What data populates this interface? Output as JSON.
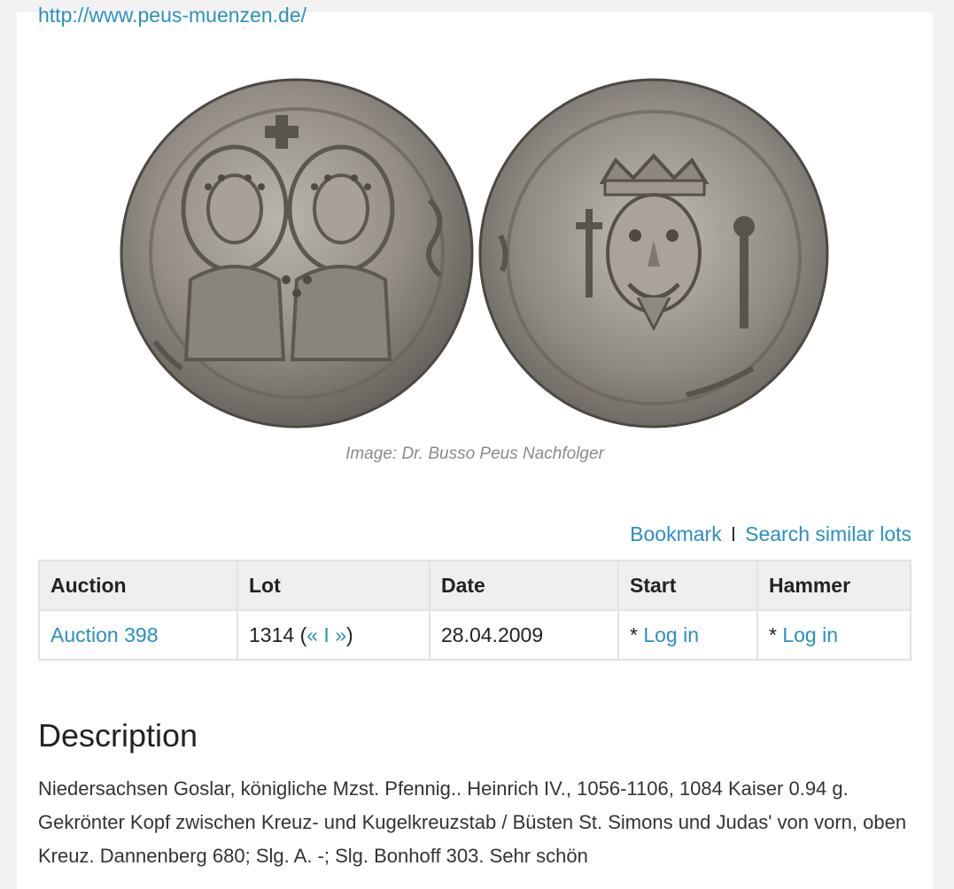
{
  "header": {
    "source_url": "http://www.peus-muenzen.de/"
  },
  "image": {
    "caption": "Image: Dr. Busso Peus Nachfolger"
  },
  "actions": {
    "bookmark": "Bookmark",
    "separator": "I",
    "search_similar": "Search similar lots"
  },
  "table": {
    "headers": [
      "Auction",
      "Lot",
      "Date",
      "Start",
      "Hammer"
    ],
    "row": {
      "auction": "Auction 398",
      "lot_number": "1314",
      "lot_open": "(",
      "lot_prev": "«",
      "lot_sep": "I",
      "lot_next": "»",
      "lot_close": ")",
      "date": "28.04.2009",
      "start_prefix": "*",
      "start_link": "Log in",
      "hammer_prefix": "*",
      "hammer_link": "Log in"
    }
  },
  "description": {
    "heading": "Description",
    "text": "Niedersachsen Goslar, königliche Mzst. Pfennig.. Heinrich IV., 1056-1106, 1084 Kaiser 0.94 g. Gekrönter Kopf zwischen Kreuz- und Kugelkreuzstab / Büsten St. Simons und Judas' von vorn, oben Kreuz. Dannenberg 680; Slg. A. -; Slg. Bonhoff 303. Sehr schön"
  }
}
